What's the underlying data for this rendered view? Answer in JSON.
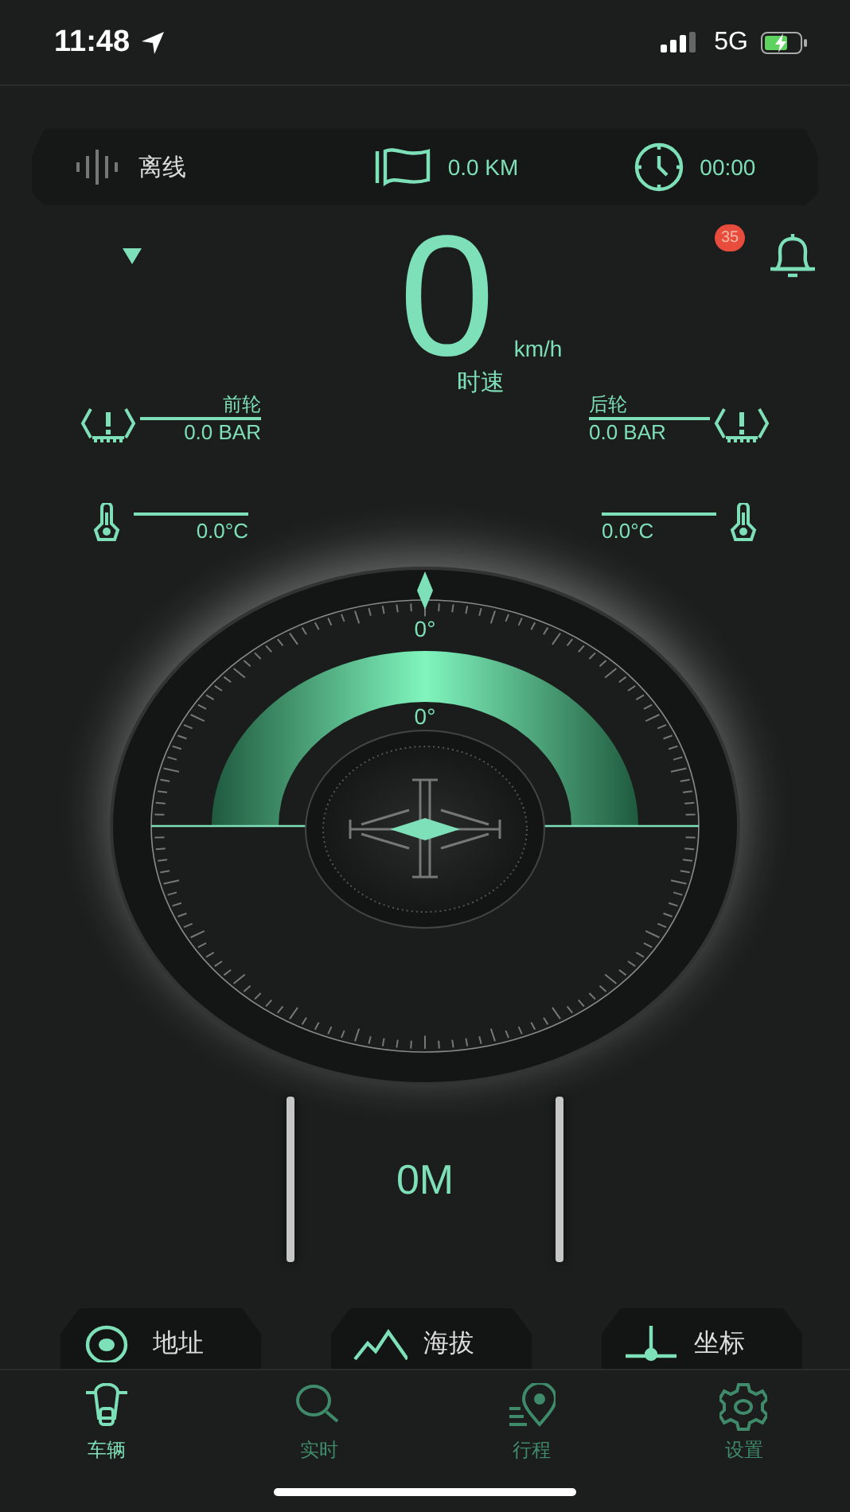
{
  "status_bar": {
    "time": "11:48",
    "network": "5G"
  },
  "info_bar": {
    "connection": "离线",
    "distance": "0.0 KM",
    "duration": "00:00"
  },
  "notifications": {
    "count": "35"
  },
  "speed": {
    "value": "0",
    "unit": "km/h",
    "label": "时速"
  },
  "tires": [
    {
      "name": "前轮",
      "pressure": "0.0 BAR",
      "temperature": "0.0°C"
    },
    {
      "name": "后轮",
      "pressure": "0.0 BAR",
      "temperature": "0.0°C"
    }
  ],
  "gauge": {
    "heading": "0°",
    "tilt": "0°"
  },
  "altitude": {
    "value": "0M"
  },
  "cards": [
    {
      "kind": "address",
      "label": "地址"
    },
    {
      "kind": "altitude",
      "label": "海拔"
    },
    {
      "kind": "coordinates",
      "label": "坐标"
    }
  ],
  "tabs": [
    {
      "kind": "vehicle",
      "label": "车辆",
      "selected": true
    },
    {
      "kind": "realtime",
      "label": "实时",
      "selected": false
    },
    {
      "kind": "trip",
      "label": "行程",
      "selected": false
    },
    {
      "kind": "settings",
      "label": "设置",
      "selected": false
    }
  ]
}
